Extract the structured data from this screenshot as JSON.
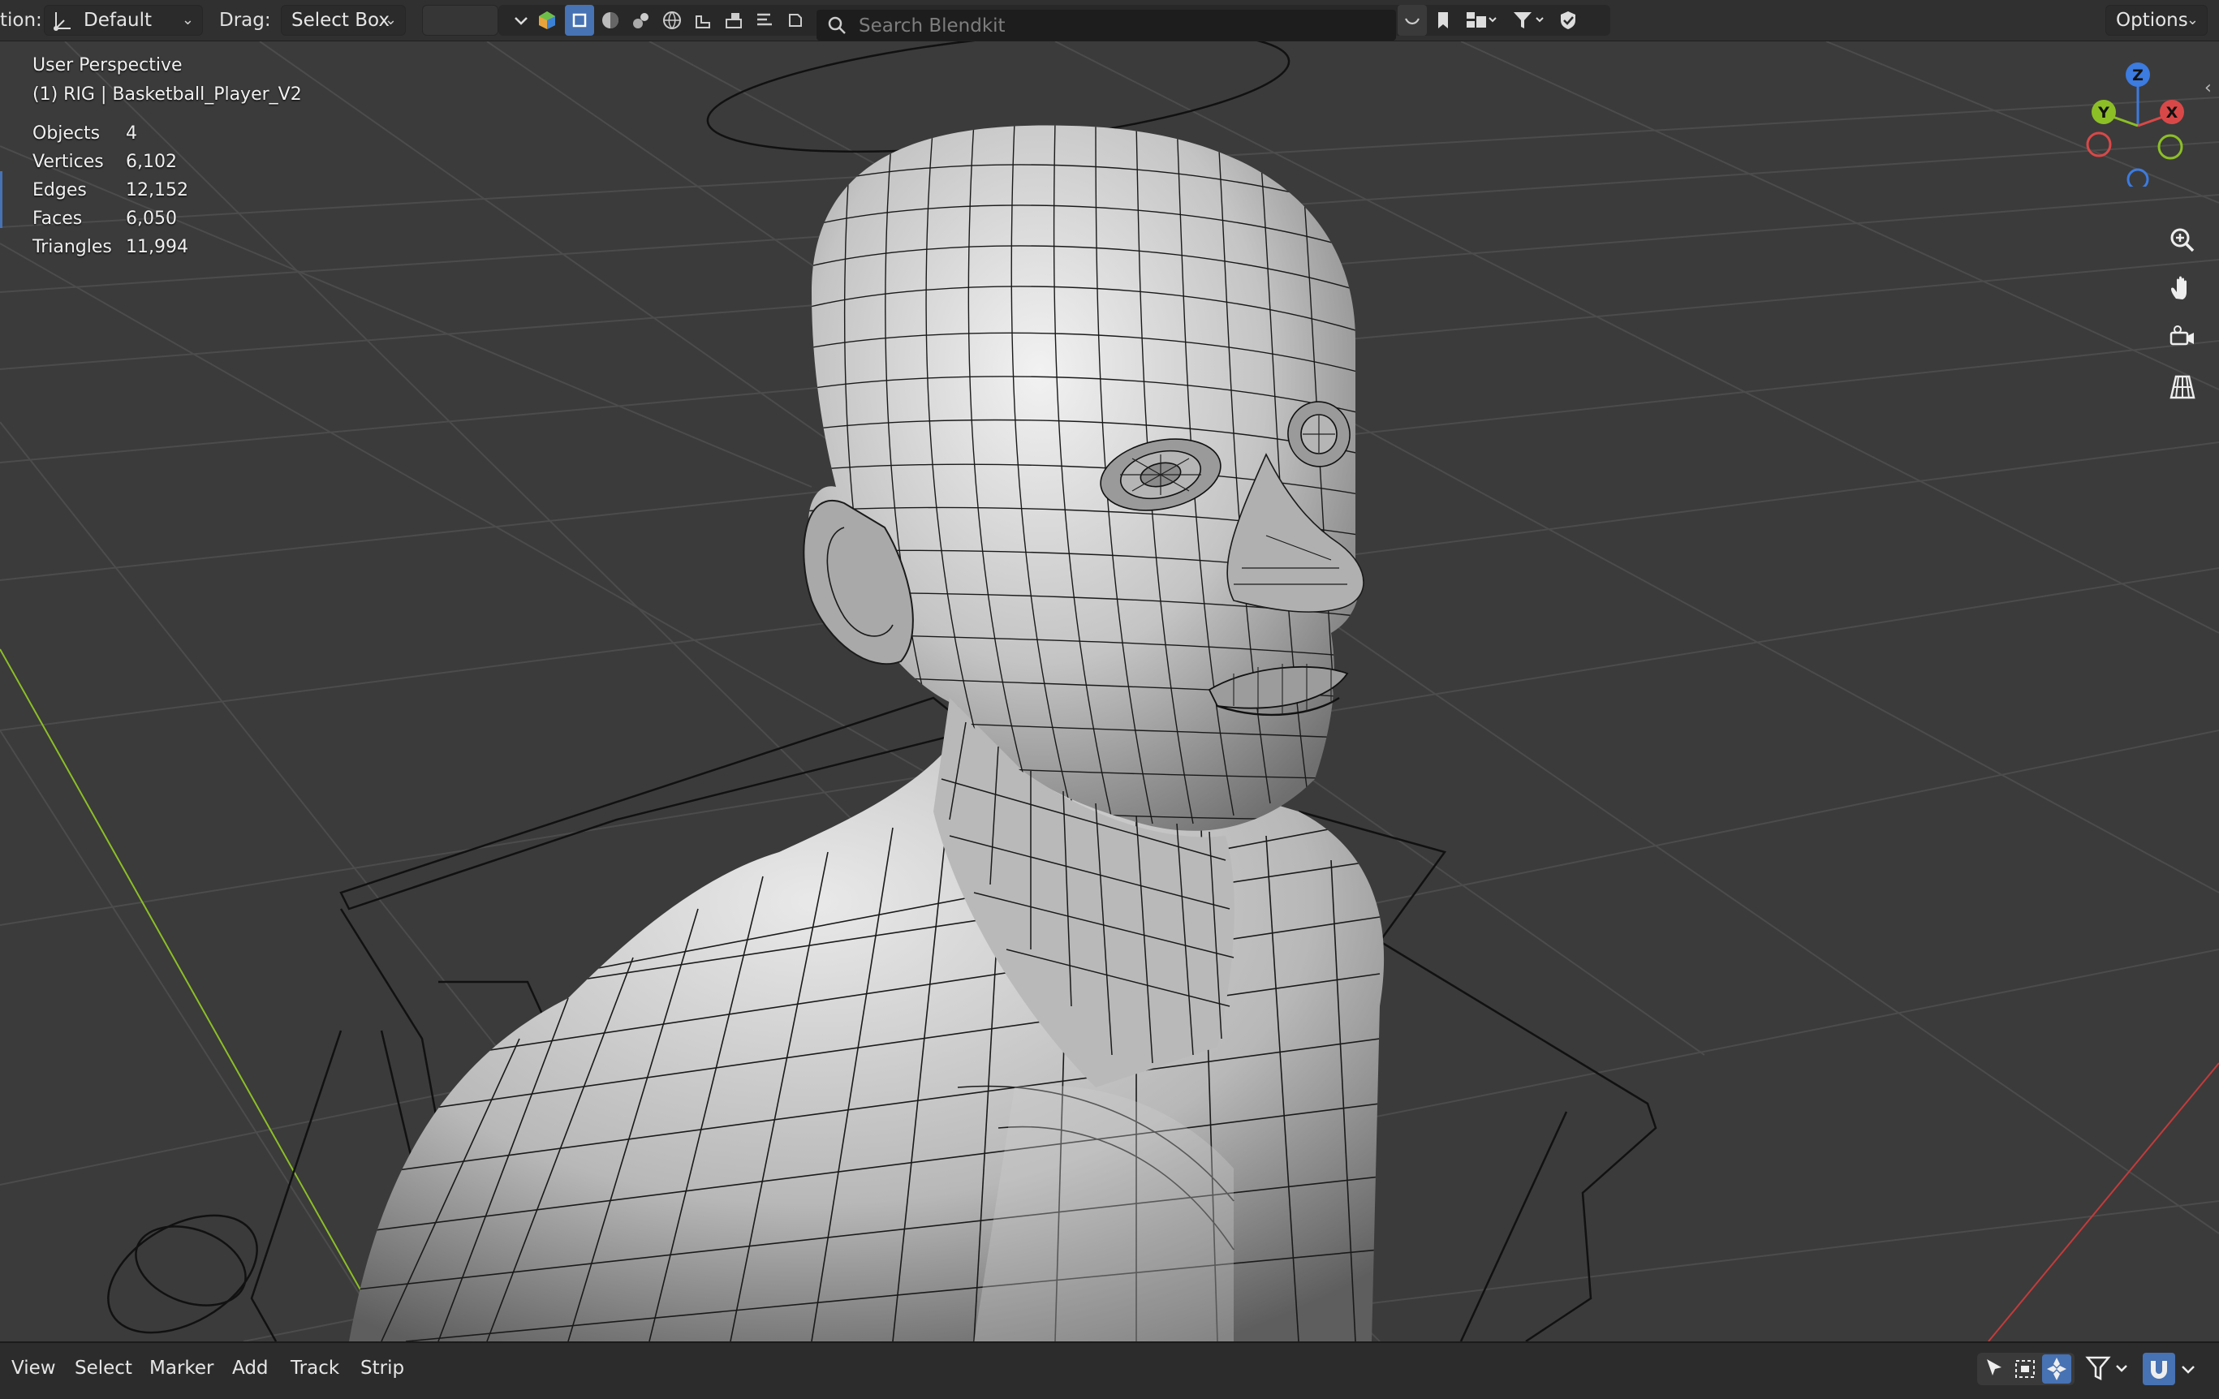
{
  "topbar": {
    "orientation_label": "tion:",
    "orientation_value": "Default",
    "drag_label": "Drag:",
    "drag_value": "Select Box",
    "search_placeholder": "Search Blendkit",
    "options_label": "Options"
  },
  "viewport": {
    "view_name": "User Perspective",
    "object_name": "(1) RIG | Basketball_Player_V2",
    "stats": [
      {
        "label": "Objects",
        "value": "4"
      },
      {
        "label": "Vertices",
        "value": "6,102"
      },
      {
        "label": "Edges",
        "value": "12,152"
      },
      {
        "label": "Faces",
        "value": "6,050"
      },
      {
        "label": "Triangles",
        "value": "11,994"
      }
    ],
    "gizmo": {
      "x": "X",
      "y": "Y",
      "z": "Z"
    }
  },
  "bottombar": {
    "menus": [
      "View",
      "Select",
      "Marker",
      "Add",
      "Track",
      "Strip"
    ]
  },
  "colors": {
    "accent": "#4772b3",
    "axis_x": "#d94848",
    "axis_y": "#8cbf26",
    "axis_z": "#3c7be0",
    "background": "#3b3b3b"
  }
}
